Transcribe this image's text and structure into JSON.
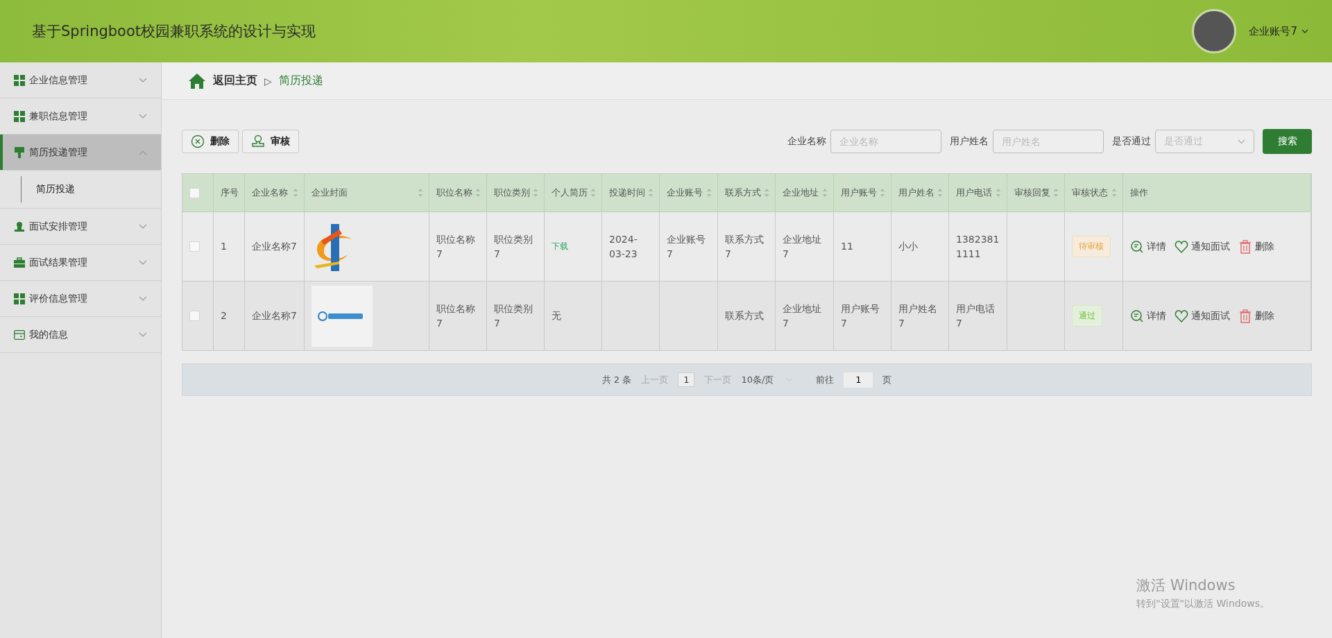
{
  "header": {
    "title": "基于Springboot校园兼职系统的设计与实现",
    "user": "企业账号7"
  },
  "sidebar": {
    "items": [
      {
        "label": "企业信息管理",
        "expanded": false,
        "selected": false
      },
      {
        "label": "兼职信息管理",
        "expanded": false,
        "selected": false
      },
      {
        "label": "简历投递管理",
        "expanded": true,
        "selected": true,
        "children": [
          {
            "label": "简历投递"
          }
        ]
      },
      {
        "label": "面试安排管理",
        "expanded": false,
        "selected": false
      },
      {
        "label": "面试结果管理",
        "expanded": false,
        "selected": false
      },
      {
        "label": "评价信息管理",
        "expanded": false,
        "selected": false
      },
      {
        "label": "我的信息",
        "expanded": false,
        "selected": false
      }
    ]
  },
  "breadcrumb": {
    "home": "返回主页",
    "separator": "▷",
    "current": "简历投递"
  },
  "toolbar": {
    "buttons": [
      {
        "label": "删除",
        "kind": "delete"
      },
      {
        "label": "审核",
        "kind": "review"
      }
    ]
  },
  "search": {
    "fields": [
      {
        "label": "企业名称",
        "placeholder": "企业名称",
        "kind": "input"
      },
      {
        "label": "用户姓名",
        "placeholder": "用户姓名",
        "kind": "input"
      },
      {
        "label": "是否通过",
        "placeholder": "是否通过",
        "kind": "select"
      }
    ],
    "button": "搜索"
  },
  "table": {
    "select_all": {
      "checked": false
    },
    "columns": [
      {
        "label": "序号",
        "sortable": false
      },
      {
        "label": "企业名称",
        "sortable": true
      },
      {
        "label": "企业封面",
        "sortable": true
      },
      {
        "label": "职位名称",
        "sortable": true
      },
      {
        "label": "职位类别",
        "sortable": true
      },
      {
        "label": "个人简历",
        "sortable": true
      },
      {
        "label": "投递时间",
        "sortable": true
      },
      {
        "label": "企业账号",
        "sortable": true
      },
      {
        "label": "联系方式",
        "sortable": true
      },
      {
        "label": "企业地址",
        "sortable": true
      },
      {
        "label": "用户账号",
        "sortable": true
      },
      {
        "label": "用户姓名",
        "sortable": true
      },
      {
        "label": "用户电话",
        "sortable": true
      },
      {
        "label": "审核回复",
        "sortable": true
      },
      {
        "label": "审核状态",
        "sortable": true
      },
      {
        "label": "操作",
        "sortable": false
      }
    ],
    "rows": [
      {
        "checked": false,
        "index": "1",
        "company": "企业名称7",
        "position": "职位名称7",
        "category": "职位类别7",
        "resume": {
          "text": "下载",
          "kind": "link"
        },
        "time": "2024-03-23",
        "account": "企业账号7",
        "contact": "联系方式7",
        "address": "企业地址7",
        "user_account": "11",
        "user_name": "小小",
        "phone": "13823811111",
        "status": {
          "text": "待审核",
          "kind": "pending"
        },
        "actions": [
          "详情",
          "通知面试",
          "删除"
        ]
      },
      {
        "checked": false,
        "index": "2",
        "company": "企业名称7",
        "position": "职位名称7",
        "category": "职位类别7",
        "resume": {
          "text": "无",
          "kind": "text"
        },
        "contact": "联系方式",
        "address": "企业地址7",
        "user_account": "用户账号7",
        "user_name": "用户姓名7",
        "phone": "用户电话7",
        "status": {
          "text": "通过",
          "kind": "passed"
        },
        "actions": [
          "详情",
          "通知面试",
          "删除"
        ]
      }
    ]
  },
  "pagination": {
    "total": "共 2 条",
    "prev": "上一页",
    "page": "1",
    "next": "下一页",
    "page_size": "10条/页",
    "goto": "前往",
    "goto_value": "1",
    "page_unit": "页"
  },
  "windows_notice": {
    "title": "激活 Windows",
    "text": "转到\"设置\"以激活 Windows。"
  }
}
